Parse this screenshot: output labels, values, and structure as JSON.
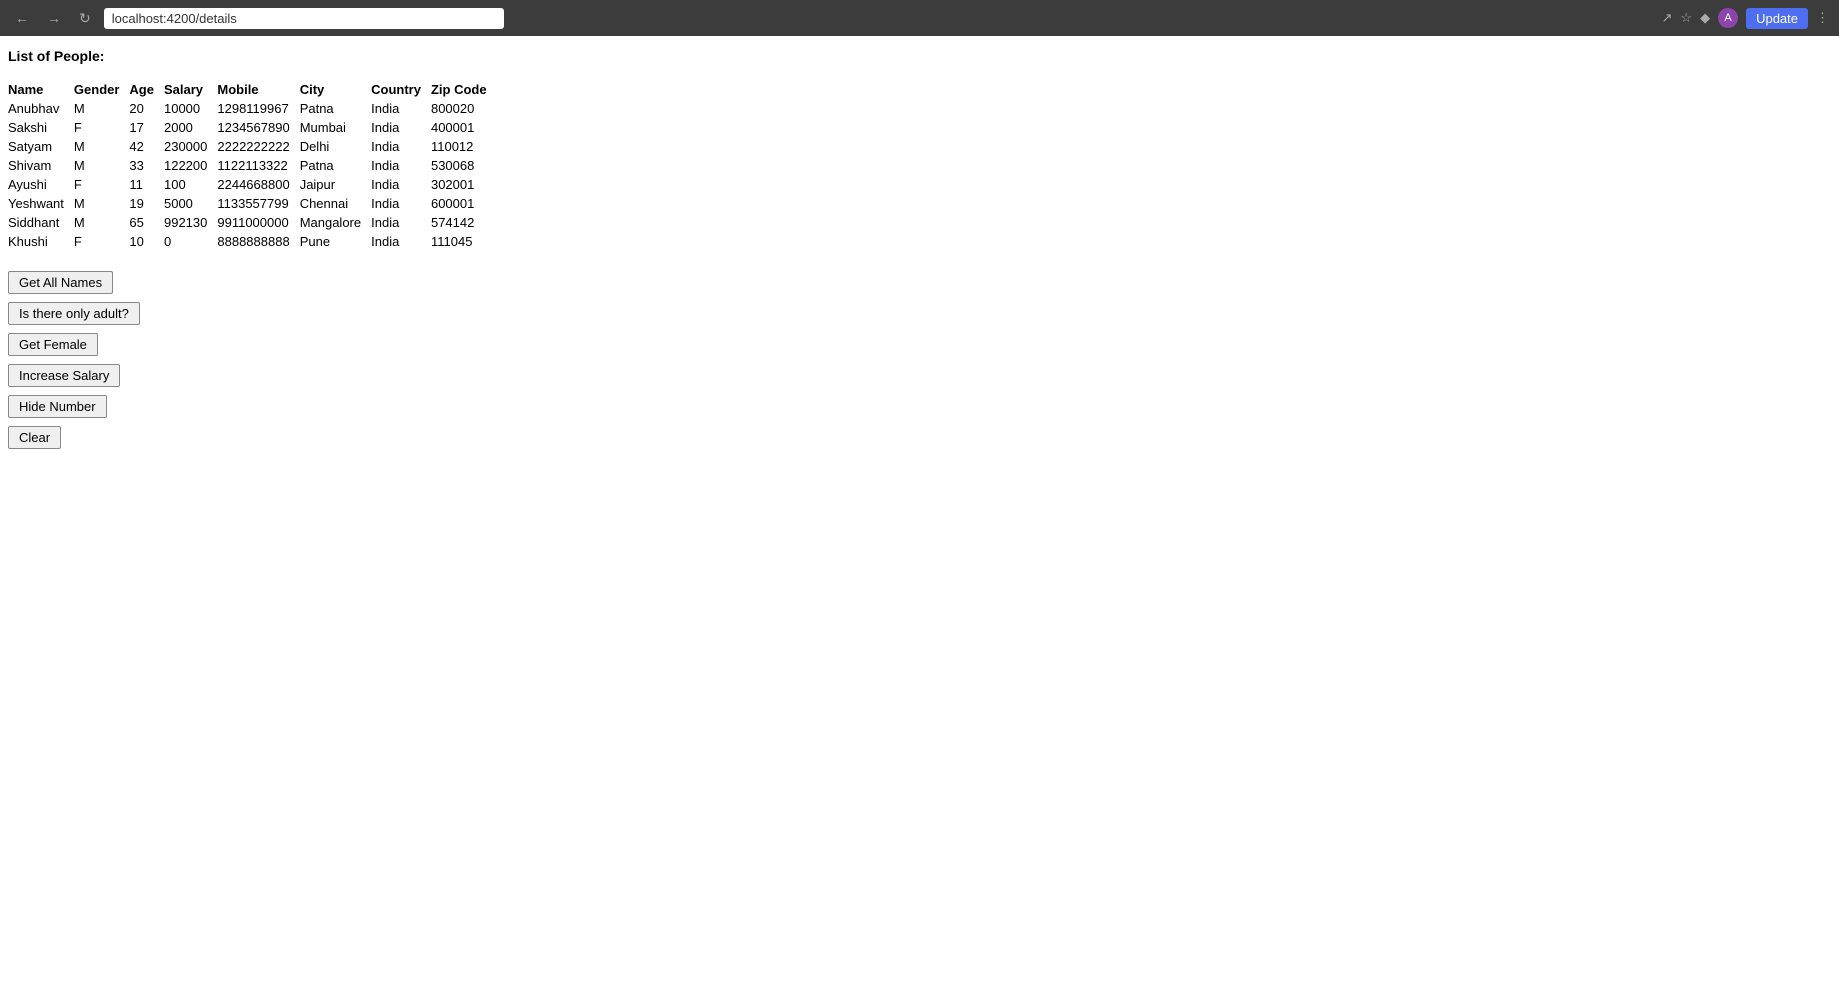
{
  "browser": {
    "url": "localhost:4200/details",
    "update_label": "Update"
  },
  "page": {
    "title": "List of People:"
  },
  "table": {
    "headers": [
      "Name",
      "Gender",
      "Age",
      "Salary",
      "Mobile",
      "City",
      "Country",
      "Zip Code"
    ],
    "rows": [
      [
        "Anubhav",
        "M",
        "20",
        "10000",
        "1298119967",
        "Patna",
        "India",
        "800020"
      ],
      [
        "Sakshi",
        "F",
        "17",
        "2000",
        "1234567890",
        "Mumbai",
        "India",
        "400001"
      ],
      [
        "Satyam",
        "M",
        "42",
        "230000",
        "2222222222",
        "Delhi",
        "India",
        "110012"
      ],
      [
        "Shivam",
        "M",
        "33",
        "122200",
        "1122113322",
        "Patna",
        "India",
        "530068"
      ],
      [
        "Ayushi",
        "F",
        "11",
        "100",
        "2244668800",
        "Jaipur",
        "India",
        "302001"
      ],
      [
        "Yeshwant",
        "M",
        "19",
        "5000",
        "1133557799",
        "Chennai",
        "India",
        "600001"
      ],
      [
        "Siddhant",
        "M",
        "65",
        "992130",
        "9911000000",
        "Mangalore",
        "India",
        "574142"
      ],
      [
        "Khushi",
        "F",
        "10",
        "0",
        "8888888888",
        "Pune",
        "India",
        "111045"
      ]
    ]
  },
  "buttons": {
    "get_all_names": "Get All Names",
    "is_adult": "Is there only adult?",
    "get_female": "Get Female",
    "increase_salary": "Increase Salary",
    "hide_number": "Hide Number",
    "clear": "Clear"
  }
}
